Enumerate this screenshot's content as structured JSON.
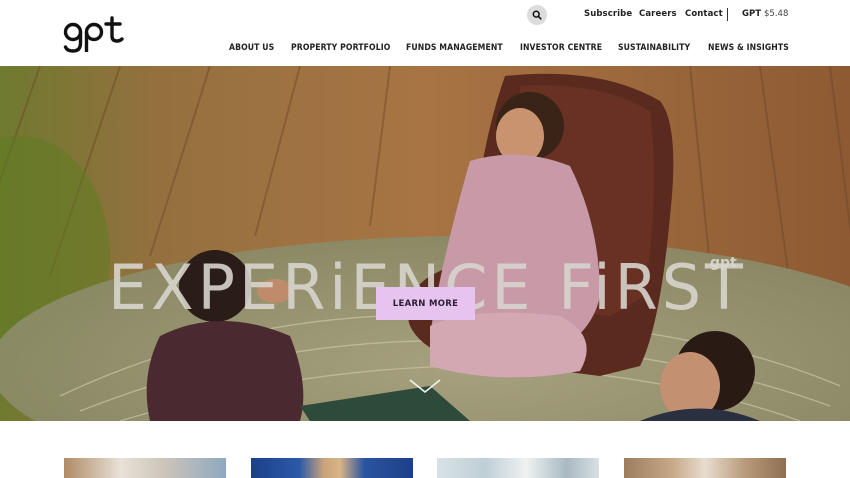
{
  "header": {
    "logo_text": "gpt",
    "utility": {
      "subscribe": "Subscribe",
      "careers": "Careers",
      "contact": "Contact",
      "share_code": "GPT",
      "share_price": "$5.48"
    },
    "nav": [
      "ABOUT US",
      "PROPERTY PORTFOLIO",
      "FUNDS MANAGEMENT",
      "INVESTOR CENTRE",
      "SUSTAINABILITY",
      "NEWS & INSIGHTS"
    ]
  },
  "hero": {
    "headline": "EXPERiENCE FiRST",
    "headline_brand": "gpt",
    "cta_label": "LEARN MORE"
  },
  "icons": {
    "search": "search-icon",
    "scroll": "chevron-down-icon"
  },
  "colors": {
    "cta_background": "#e7c4ef",
    "text": "#222222"
  }
}
